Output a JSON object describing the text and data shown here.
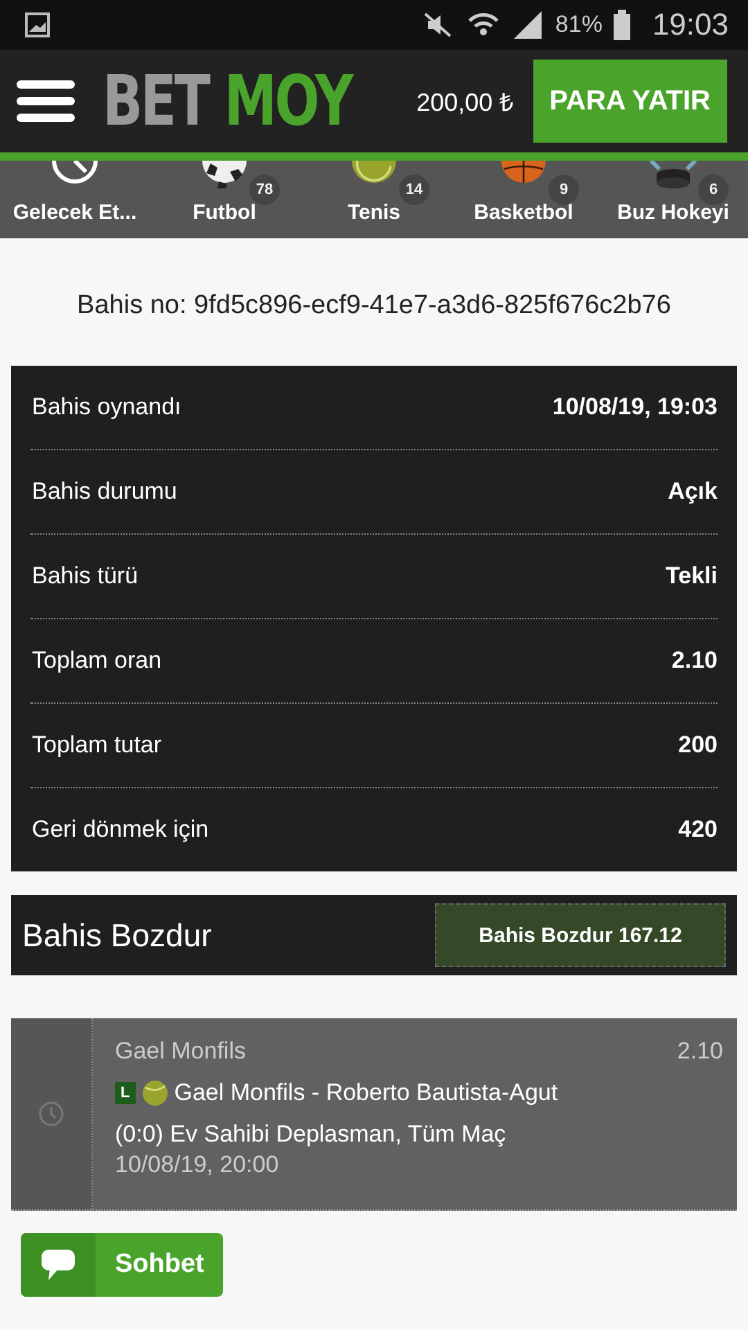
{
  "status_bar": {
    "battery": "81%",
    "time": "19:03"
  },
  "header": {
    "logo_left": "BET",
    "logo_right": "MOY",
    "balance": "200,00 ₺",
    "deposit_button": "PARA YATIR"
  },
  "sports": [
    {
      "kind": "clock",
      "label": "Gelecek Et..."
    },
    {
      "kind": "football",
      "label": "Futbol",
      "count": "78"
    },
    {
      "kind": "tennis",
      "label": "Tenis",
      "count": "14"
    },
    {
      "kind": "basketball",
      "label": "Basketbol",
      "count": "9"
    },
    {
      "kind": "hockey",
      "label": "Buz Hokeyi",
      "count": "6"
    }
  ],
  "bet_number": "Bahis no: 9fd5c896-ecf9-41e7-a3d6-825f676c2b76",
  "details": [
    {
      "label": "Bahis oynandı",
      "value": "10/08/19, 19:03"
    },
    {
      "label": "Bahis durumu",
      "value": "Açık"
    },
    {
      "label": "Bahis türü",
      "value": "Tekli"
    },
    {
      "label": "Toplam oran",
      "value": "2.10"
    },
    {
      "label": "Toplam tutar",
      "value": "200"
    },
    {
      "label": "Geri dönmek için",
      "value": "420"
    }
  ],
  "cashout": {
    "title": "Bahis Bozdur",
    "button": "Bahis Bozdur 167.12"
  },
  "selection": {
    "pick": "Gael Monfils",
    "odds": "2.10",
    "live_badge": "L",
    "match": "Gael Monfils - Roberto Bautista-Agut",
    "market": "(0:0) Ev Sahibi Deplasman, Tüm Maç",
    "date": "10/08/19, 20:00"
  },
  "chat_button": "Sohbet"
}
